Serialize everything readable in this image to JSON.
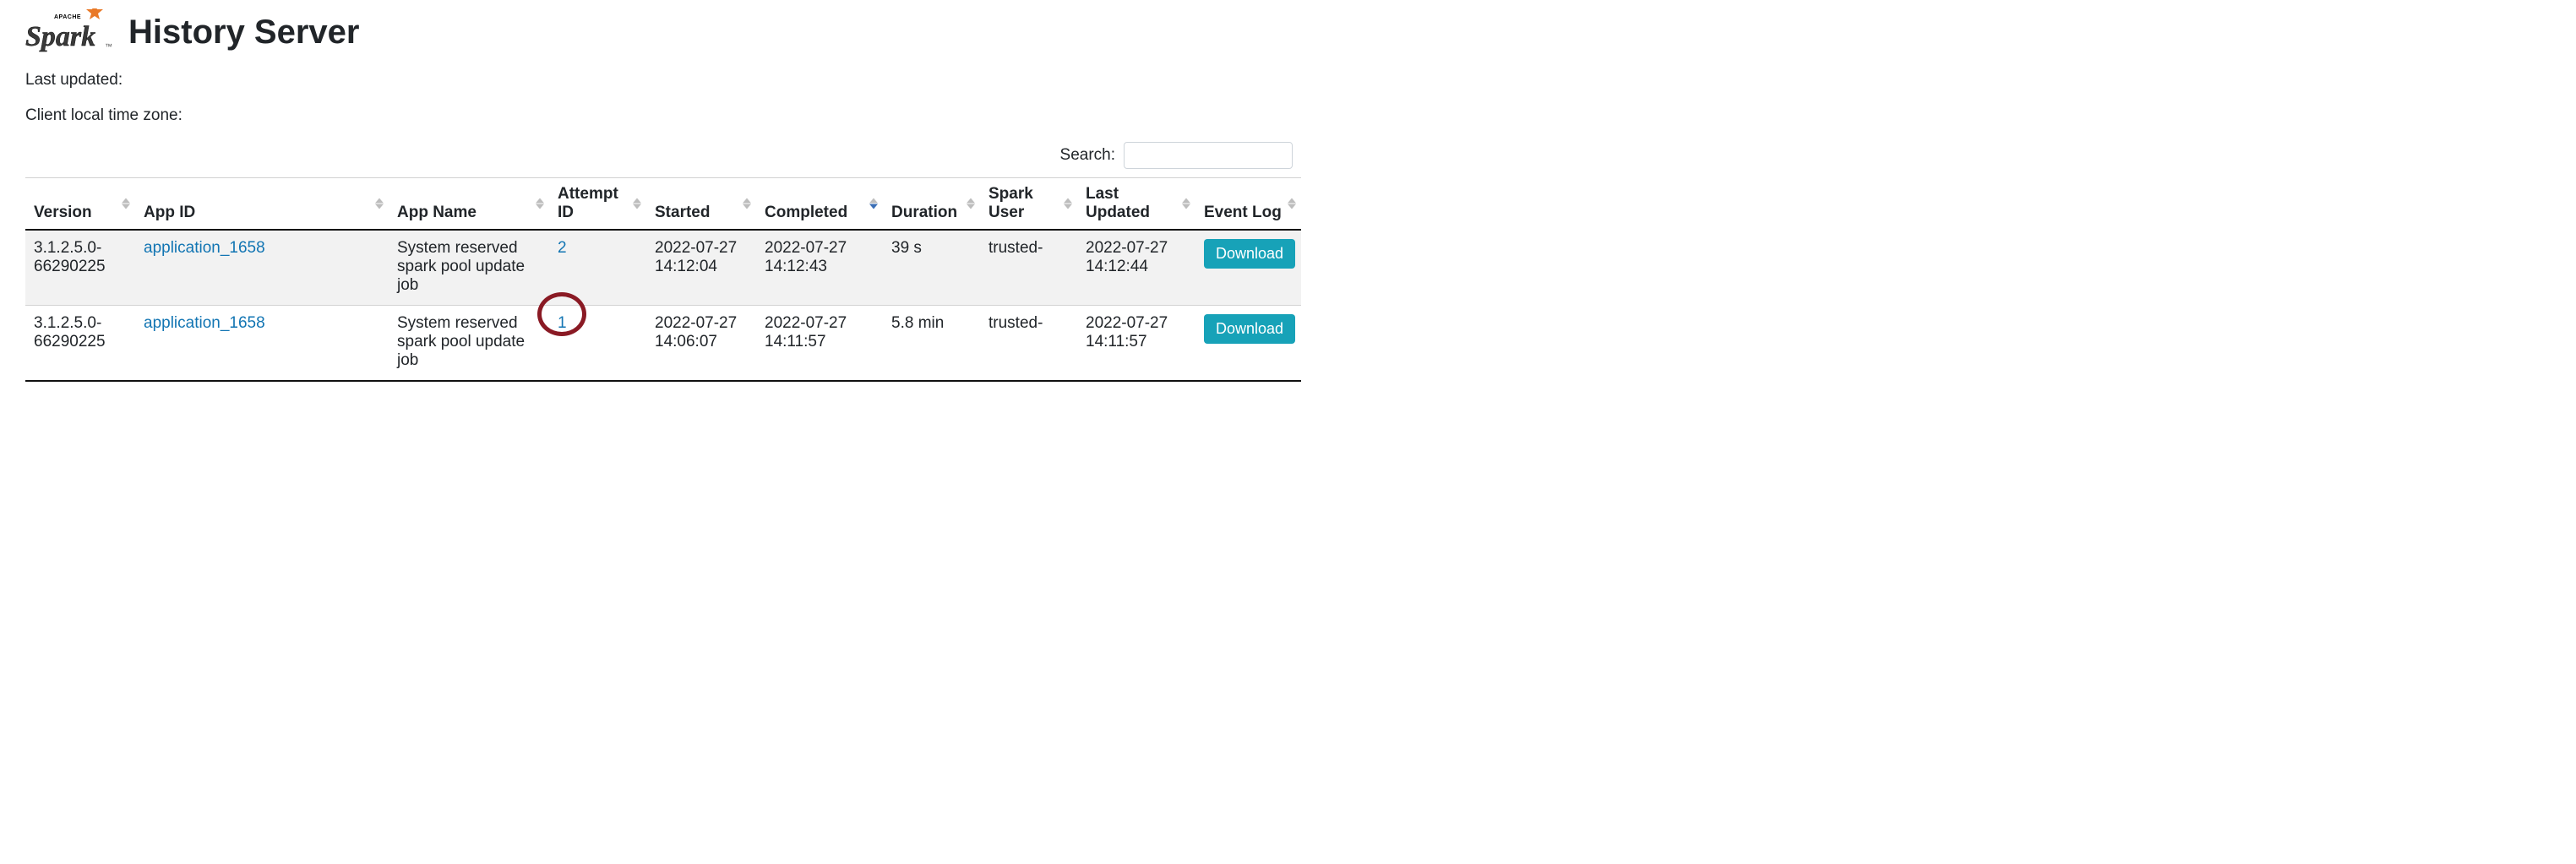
{
  "header": {
    "logo_main": "Spark",
    "logo_sup": "APACHE",
    "title": "History Server"
  },
  "meta": {
    "last_updated_label": "Last updated:",
    "client_tz_label": "Client local time zone:"
  },
  "search": {
    "label": "Search:",
    "value": ""
  },
  "columns": {
    "version": "Version",
    "app_id": "App ID",
    "app_name": "App Name",
    "attempt_id": "Attempt ID",
    "started": "Started",
    "completed": "Completed",
    "duration": "Duration",
    "spark_user": "Spark User",
    "last_updated": "Last Updated",
    "event_log": "Event Log"
  },
  "rows": [
    {
      "version": "3.1.2.5.0-66290225",
      "app_id": "application_1658",
      "app_name": "System reserved spark pool update job",
      "attempt_id": "2",
      "started": "2022-07-27 14:12:04",
      "completed": "2022-07-27 14:12:43",
      "duration": "39 s",
      "spark_user": "trusted-",
      "last_updated": "2022-07-27 14:12:44",
      "download_label": "Download",
      "highlighted": false
    },
    {
      "version": "3.1.2.5.0-66290225",
      "app_id": "application_1658",
      "app_name": "System reserved spark pool update job",
      "attempt_id": "1",
      "started": "2022-07-27 14:06:07",
      "completed": "2022-07-27 14:11:57",
      "duration": "5.8 min",
      "spark_user": "trusted-",
      "last_updated": "2022-07-27 14:11:57",
      "download_label": "Download",
      "highlighted": true
    }
  ]
}
